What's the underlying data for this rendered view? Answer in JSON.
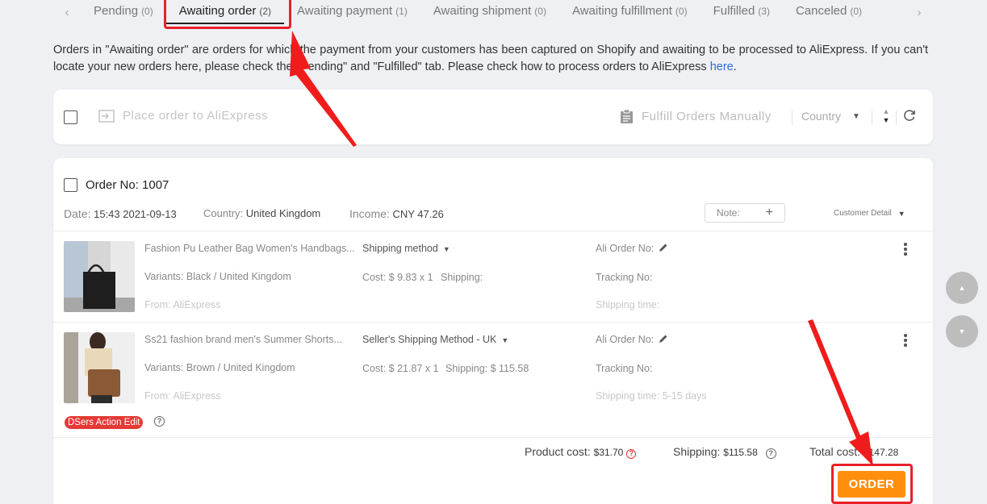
{
  "tabs": [
    {
      "label": "Pending",
      "count": "(0)"
    },
    {
      "label": "Awaiting order",
      "count": "(2)"
    },
    {
      "label": "Awaiting payment",
      "count": "(1)"
    },
    {
      "label": "Awaiting shipment",
      "count": "(0)"
    },
    {
      "label": "Awaiting fulfillment",
      "count": "(0)"
    },
    {
      "label": "Fulfilled",
      "count": "(3)"
    },
    {
      "label": "Canceled",
      "count": "(0)"
    }
  ],
  "info": {
    "text": "Orders in \"Awaiting order\" are orders for which the payment from your customers has been captured on Shopify and awaiting to be processed to AliExpress. If you can't locate your new orders here, please check the \"Pending\" and \"Fulfilled\" tab. Please check how to process orders to AliExpress ",
    "link": "here",
    "end": "."
  },
  "actionbar": {
    "place_order": "Place order to AliExpress",
    "fulfill": "Fulfill Orders Manually",
    "country": "Country"
  },
  "order": {
    "number": "Order No: 1007",
    "date_label": "Date:",
    "date": "15:43 2021-09-13",
    "country_label": "Country:",
    "country": "United Kingdom",
    "income_label": "Income:",
    "income": "CNY 47.26",
    "note": "Note:",
    "customer_detail": "Customer Detail",
    "items": [
      {
        "title": "Fashion Pu Leather Bag Women's Handbags...",
        "variants": "Variants: Black / United Kingdom",
        "from": "From: AliExpress",
        "shipping_method": "Shipping method",
        "cost": "Cost: $ 9.83 x 1",
        "shipping": "Shipping:",
        "ali_order": "Ali Order No:",
        "tracking": "Tracking No:",
        "shipping_time": "Shipping time:"
      },
      {
        "title": "Ss21 fashion brand men's Summer Shorts...",
        "variants": "Variants: Brown / United Kingdom",
        "from": "From: AliExpress",
        "shipping_method": "Seller's Shipping Method - UK",
        "cost": "Cost: $ 21.87 x 1",
        "shipping": "Shipping: $ 115.58",
        "ali_order": "Ali Order No:",
        "tracking": "Tracking No:",
        "shipping_time": "Shipping time: 5-15 days"
      }
    ],
    "badge": "DSers Action Edit",
    "product_cost_label": "Product cost:",
    "product_cost": "$31.70",
    "shipping_label": "Shipping:",
    "shipping_total": "$115.58",
    "total_label": "Total cost:",
    "total": "$147.28",
    "order_button": "ORDER"
  },
  "colors": {
    "accent": "#ff8f0d",
    "annotation": "#e8202a",
    "link": "#2a6dd9"
  }
}
